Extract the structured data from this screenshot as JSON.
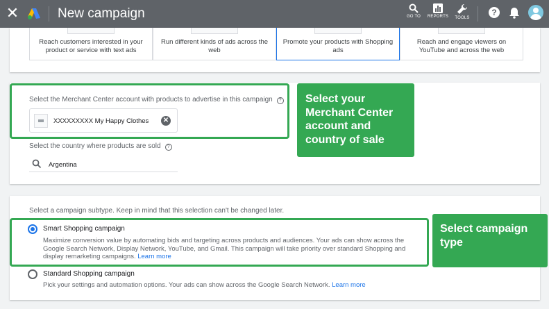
{
  "header": {
    "close_icon": "close-icon",
    "logo_icon": "google-ads-logo",
    "title": "New campaign",
    "tools": [
      {
        "icon": "search-icon",
        "label": "GO TO"
      },
      {
        "icon": "reports-icon",
        "label": "REPORTS"
      },
      {
        "icon": "wrench-icon",
        "label": "TOOLS"
      }
    ],
    "help_glyph": "?",
    "help_icon": "help-icon",
    "notifications_icon": "bell-icon",
    "avatar_icon": "account-avatar"
  },
  "goals": [
    {
      "text": "Reach customers interested in your product or service with text ads",
      "selected": false
    },
    {
      "text": "Run different kinds of ads across the web",
      "selected": false
    },
    {
      "text": "Promote your products with Shopping ads",
      "selected": true
    },
    {
      "text": "Reach and engage viewers on YouTube and across the web",
      "selected": false
    }
  ],
  "merchant": {
    "label": "Select the Merchant Center account with products to advertise in this campaign",
    "help_glyph": "?",
    "account_text": "XXXXXXXXX  My Happy Clothes",
    "clear_glyph": "✕",
    "country_label": "Select the country where products are sold",
    "country_value": "Argentina"
  },
  "callouts": {
    "merchant": "Select your Merchant Center account and country of sale",
    "campaign_type": "Select campaign type"
  },
  "subtype": {
    "label": "Select a campaign subtype. Keep in mind that this selection can't be changed later.",
    "options": [
      {
        "title": "Smart Shopping campaign",
        "description": "Maximize conversion value by automating bids and targeting across products and audiences. Your ads can show across the Google Search Network, Display Network, YouTube, and Gmail. This campaign will take priority over standard Shopping and display remarketing campaigns.",
        "link": "Learn more",
        "selected": true
      },
      {
        "title": "Standard Shopping campaign",
        "description": "Pick your settings and automation options. Your ads can show across the Google Search Network.",
        "link": "Learn more",
        "selected": false
      }
    ]
  },
  "colors": {
    "topbar": "#5f6368",
    "highlight": "#34a853",
    "accent": "#1a73e8"
  }
}
